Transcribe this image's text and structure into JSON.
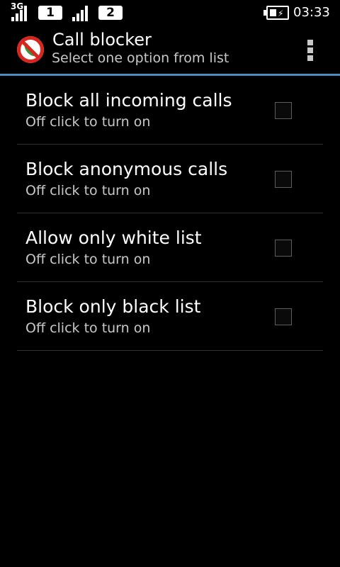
{
  "status_bar": {
    "network_type": "3G",
    "sim1_label": "1",
    "sim2_label": "2",
    "time": "03:33",
    "battery_state": "charging",
    "icons": [
      "signal-strength-icon",
      "sim-1-icon",
      "signal-strength-icon",
      "sim-2-icon",
      "battery-charging-icon"
    ]
  },
  "action_bar": {
    "title": "Call blocker",
    "subtitle": "Select one option from list",
    "app_icon": "blocked-phone-icon",
    "overflow_icon": "overflow-menu-icon",
    "accent_color": "#4a8fbf"
  },
  "options": [
    {
      "title": "Block all incoming calls",
      "summary": "Off click to turn on",
      "checked": false
    },
    {
      "title": "Block anonymous calls",
      "summary": "Off click to turn on",
      "checked": false
    },
    {
      "title": "Allow only white list",
      "summary": "Off click to turn on",
      "checked": false
    },
    {
      "title": "Block only black list",
      "summary": "Off click to turn on",
      "checked": false
    }
  ]
}
